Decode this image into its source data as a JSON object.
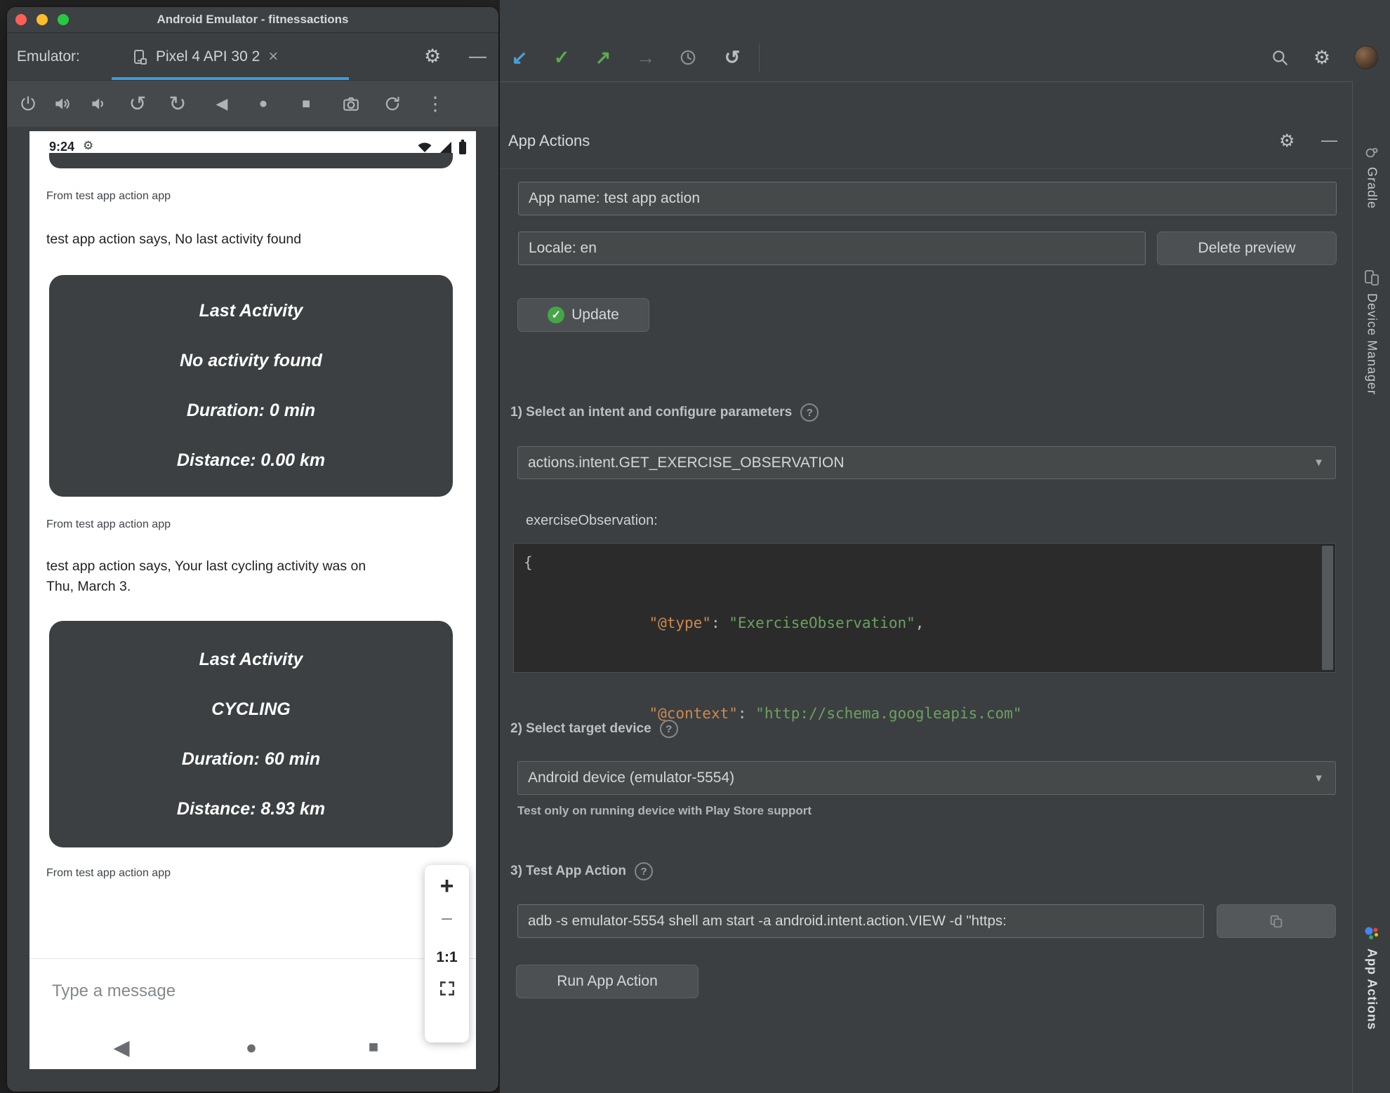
{
  "icons": {
    "gear": "⚙",
    "close": "×",
    "minimize": "—",
    "more": "⋮",
    "back": "◀",
    "home": "●",
    "overview": "■",
    "rotate_left": "↺",
    "rotate_right": "↻",
    "undo": "↺",
    "arrow_pull": "↙",
    "check": "✓",
    "arrow_launch": "↗",
    "arrow_dim": "→",
    "dropdown": "▼",
    "plus": "+",
    "minus": "−",
    "help": "?"
  },
  "colors": {
    "tab_underline": "#3d9ae0",
    "update_green": "#45a548",
    "code_key": "#cc8950",
    "code_string": "#6ba25f"
  },
  "emulator": {
    "title": "Android Emulator - fitnessactions",
    "toolbar": {
      "label": "Emulator:",
      "tab": "Pixel 4 API 30 2"
    }
  },
  "phone": {
    "status": {
      "time": "9:24"
    },
    "messages": [
      {
        "from": "From test app action app",
        "text": "test app action says, No last activity found"
      },
      {
        "from": "From test app action app",
        "text": "test app action says, Your last cycling activity was on Thu, March 3."
      },
      {
        "from": "From test app action app",
        "text": ""
      }
    ],
    "cards": [
      {
        "title": "Last Activity",
        "lines": [
          "No activity found",
          "Duration: 0 min",
          "Distance: 0.00 km"
        ]
      },
      {
        "title": "Last Activity",
        "lines": [
          "CYCLING",
          "Duration: 60 min",
          "Distance: 8.93 km"
        ]
      }
    ],
    "zoom": {
      "ratio": "1:1"
    },
    "compose": {
      "placeholder": "Type a message"
    }
  },
  "studio": {
    "header": {
      "title": "App Actions"
    },
    "fields": {
      "app_name": "App name: test app action",
      "locale": "Locale: en",
      "command": "adb -s emulator-5554 shell am start -a android.intent.action.VIEW -d \"https:"
    },
    "buttons": {
      "delete_preview": "Delete preview",
      "update": "Update",
      "run": "Run App Action"
    },
    "sections": {
      "intent": {
        "label": "1) Select an intent and configure parameters",
        "dropdown": "actions.intent.GET_EXERCISE_OBSERVATION",
        "param_name": "exerciseObservation:",
        "code": {
          "open": "{",
          "close": "}",
          "lines": [
            {
              "key": "\"@type\"",
              "sep": ": ",
              "value": "\"ExerciseObservation\"",
              "tail": ","
            },
            {
              "key": "\"@context\"",
              "sep": ": ",
              "value": "\"http://schema.googleapis.com\"",
              "tail": ""
            }
          ]
        }
      },
      "device": {
        "label": "2) Select target device",
        "dropdown": "Android device (emulator-5554)",
        "hint": "Test only on running device with Play Store support"
      },
      "test": {
        "label": "3) Test App Action"
      }
    },
    "sidebar": {
      "gradle": "Gradle",
      "device_manager": "Device Manager",
      "app_actions": "App Actions"
    }
  }
}
